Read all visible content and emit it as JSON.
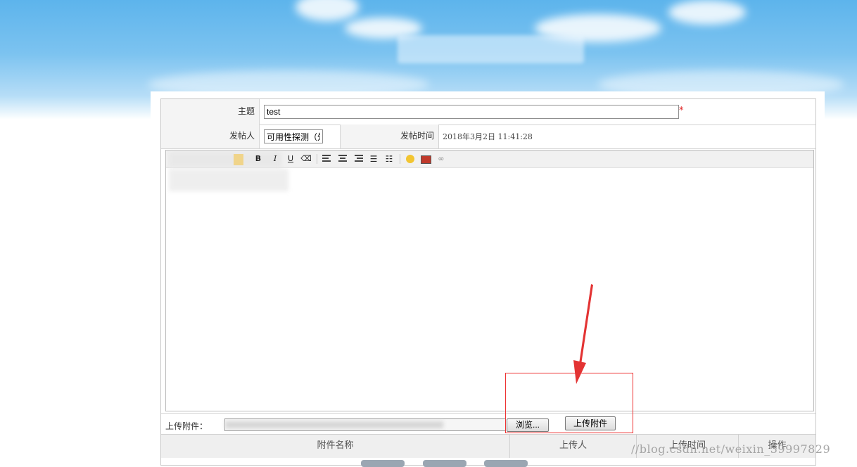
{
  "form": {
    "subject_label": "主题",
    "subject_value": "test",
    "required_mark": "*",
    "poster_label": "发帖人",
    "poster_value": "可用性探测（外",
    "post_time_label": "发帖时间",
    "post_time_value": "2018年3月2日  11:41:28"
  },
  "toolbar": {
    "bold": "B",
    "italic": "I",
    "underline": "U"
  },
  "upload": {
    "label": "上传附件：",
    "browse_button": "浏览...",
    "upload_button": "上传附件"
  },
  "attachments_table": {
    "columns": [
      "附件名称",
      "上传人",
      "上传时间",
      "操作"
    ]
  },
  "watermark": "//blog.csdn.net/weixin_39997829",
  "colors": {
    "sky": "#6dbcee",
    "annotation": "#e33333",
    "required": "#e02020"
  }
}
